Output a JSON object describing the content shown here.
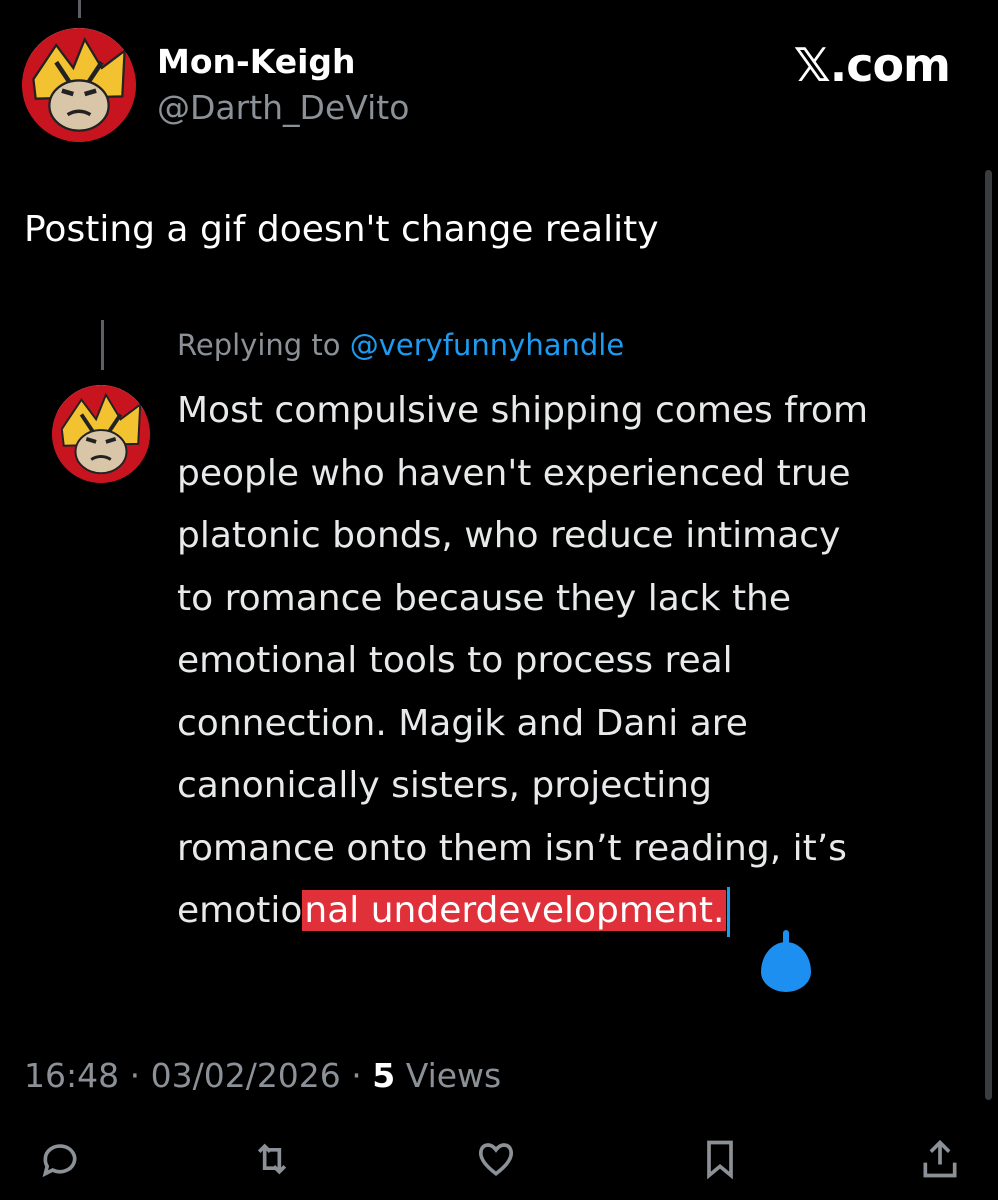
{
  "tweet": {
    "display_name": "Mon-Keigh",
    "handle": "@Darth_DeVito",
    "brand": "𝕏.com",
    "text": "Posting a gif doesn't change reality",
    "avatar_icon": "monkey-avatar-icon"
  },
  "quote": {
    "replying_prefix": "Replying to ",
    "replying_handle": "@veryfunnyhandle",
    "lines": [
      "Most compulsive shipping comes from",
      "people who haven't experienced true",
      "platonic bonds, who reduce intimacy",
      "to romance because they lack the",
      "emotional tools to process real",
      "connection. Magik and Dani are",
      "canonically sisters, projecting",
      "romance onto them isn’t reading, it’s"
    ],
    "last_line_unselected": "emotio",
    "last_line_selected": "nal underdevelopment.",
    "selection_color": "#e0303a",
    "caret_color": "#1d9bf0"
  },
  "meta": {
    "time": "16:48",
    "separator": " · ",
    "date": "03/02/2026",
    "views_count": "5",
    "views_label": " Views"
  },
  "actions": [
    {
      "name": "reply",
      "icon": "reply-icon"
    },
    {
      "name": "repost",
      "icon": "repost-icon"
    },
    {
      "name": "like",
      "icon": "heart-icon"
    },
    {
      "name": "bookmark",
      "icon": "bookmark-icon"
    },
    {
      "name": "share",
      "icon": "share-icon"
    }
  ]
}
